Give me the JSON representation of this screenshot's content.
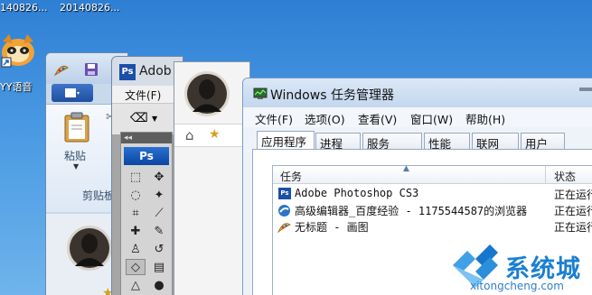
{
  "desktop": {
    "file_label_1": "140826...",
    "file_label_2": "20140826...",
    "yy_label": "YY语音"
  },
  "paint": {
    "paste_label": "粘贴",
    "clipboard_label": "剪贴板"
  },
  "photoshop": {
    "title": "Adob",
    "menu_file": "文件(F)",
    "badge": "Ps"
  },
  "task_manager": {
    "title": "Windows 任务管理器",
    "menu": [
      "文件(F)",
      "选项(O)",
      "查看(V)",
      "窗口(W)",
      "帮助(H)"
    ],
    "tabs": [
      "应用程序",
      "进程",
      "服务",
      "性能",
      "联网",
      "用户"
    ],
    "columns": {
      "task": "任务",
      "status": "状态"
    },
    "rows": [
      {
        "name": "Adobe Photoshop CS3",
        "status": "正在运行",
        "icon": "photoshop-icon"
      },
      {
        "name": "高级编辑器_百度经验 - 1175544587的浏览器",
        "status": "正在运行",
        "icon": "browser-icon"
      },
      {
        "name": "无标题 - 画图",
        "status": "正在运行",
        "icon": "paint-icon"
      }
    ]
  },
  "watermark": {
    "brand": "系统城",
    "url": "xitongcheng.com"
  },
  "colors": {
    "desktop": "#3f8fdc",
    "titlebar": "#c3d7ee",
    "photoshop_blue": "#0c46a1",
    "watermark": "#1b7fd1"
  }
}
